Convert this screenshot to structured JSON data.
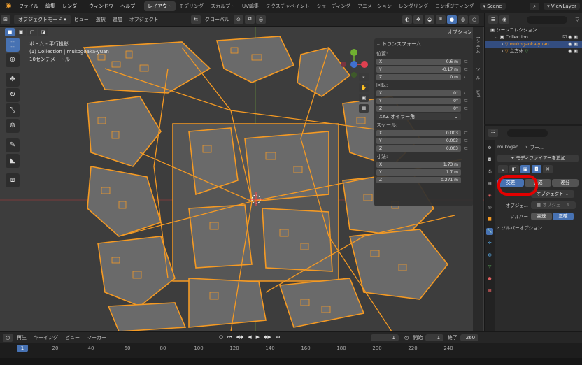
{
  "topbar": {
    "menus": [
      "ファイル",
      "編集",
      "レンダー",
      "ウィンドウ",
      "ヘルプ"
    ],
    "workspaces": [
      "レイアウト",
      "モデリング",
      "スカルプト",
      "UV編集",
      "テクスチャペイント",
      "シェーディング",
      "アニメーション",
      "レンダリング",
      "コンポジティング"
    ],
    "scene": "Scene",
    "view_layer": "ViewLayer"
  },
  "viewport_header": {
    "mode": "オブジェクトモード",
    "menus": [
      "ビュー",
      "選択",
      "追加",
      "オブジェクト"
    ],
    "transform_orientation": "グローバル",
    "options": "オプション"
  },
  "view_info": {
    "line1": "ボトム - 平行投影",
    "line2": "(1) Collection | mukogoaka-yuan",
    "line3": "10センチメートル"
  },
  "npanel": {
    "section": "トランスフォーム",
    "location_label": "位置:",
    "location": [
      {
        "axis": "X",
        "value": "-0.6 m"
      },
      {
        "axis": "Y",
        "value": "-0.17 m"
      },
      {
        "axis": "Z",
        "value": "0 m"
      }
    ],
    "rotation_label": "回転:",
    "rotation": [
      {
        "axis": "X",
        "value": "0°"
      },
      {
        "axis": "Y",
        "value": "0°"
      },
      {
        "axis": "Z",
        "value": "0°"
      }
    ],
    "rotation_mode": "XYZ オイラー角",
    "scale_label": "スケール:",
    "scale": [
      {
        "axis": "X",
        "value": "0.003"
      },
      {
        "axis": "Y",
        "value": "0.003"
      },
      {
        "axis": "Z",
        "value": "0.003"
      }
    ],
    "dimensions_label": "寸法:",
    "dimensions": [
      {
        "axis": "X",
        "value": "1.73 m"
      },
      {
        "axis": "Y",
        "value": "1.7 m"
      },
      {
        "axis": "Z",
        "value": "0.271 m"
      }
    ]
  },
  "side_tabs": [
    "アイテム",
    "ツール",
    "ビュー"
  ],
  "outliner": {
    "search_placeholder": "",
    "scene_collection": "シーンコレクション",
    "collection": "Collection",
    "object1": "mukogaoka-yuan",
    "object2": "立方体"
  },
  "properties": {
    "search_placeholder": "",
    "object_name": "mukogao...",
    "modifier_name": "ブー...",
    "add_modifier": "モディファイアーを追加",
    "op_intersect": "交差",
    "op_union": "合成",
    "op_difference": "差分",
    "operand_type": "オブジェクト",
    "object_label": "オブジェ...",
    "object_placeholder": "オブジェ...",
    "solver_label": "ソルバー",
    "solver_fast": "高速",
    "solver_exact": "正確",
    "solver_options": "ソルバーオプション"
  },
  "timeline": {
    "menus": [
      "再生",
      "キーイング",
      "ビュー",
      "マーカー"
    ],
    "current_frame": "1",
    "start_label": "開始",
    "start": "1",
    "end_label": "終了",
    "end": "260",
    "ticks": [
      "20",
      "40",
      "60",
      "80",
      "100",
      "120",
      "140",
      "160",
      "180",
      "200",
      "220",
      "240"
    ],
    "current_frame_marker": "1"
  },
  "colors": {
    "accent": "#4772b3",
    "selection_outline": "#f59a23",
    "highlight": "#e30000"
  }
}
